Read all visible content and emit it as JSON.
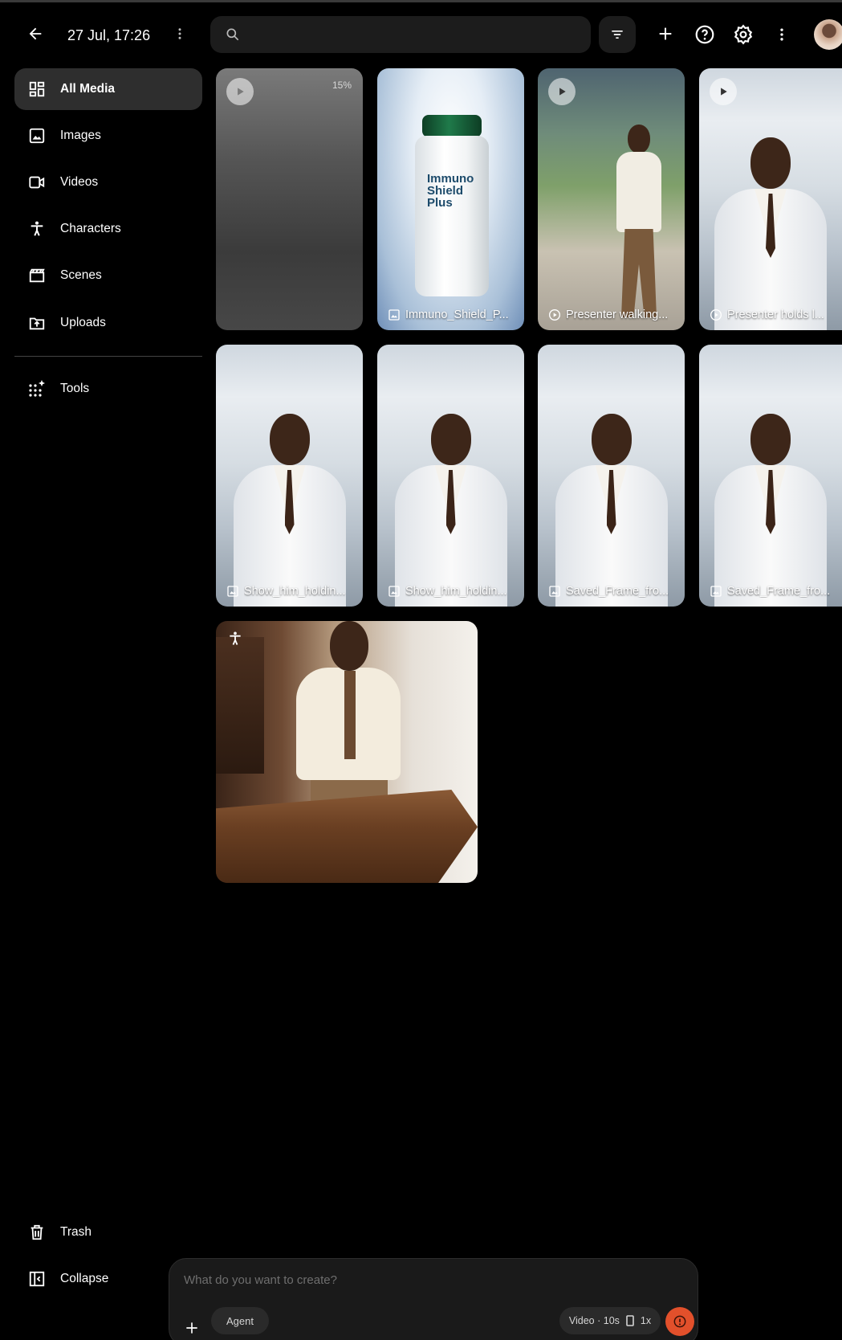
{
  "header": {
    "back_icon": "arrow-back-icon",
    "session_title": "27 Jul, 17:26",
    "search": {
      "value": "",
      "placeholder": ""
    },
    "icons": [
      "more-vert-icon",
      "search-icon",
      "filter-icon",
      "add-icon",
      "help-icon",
      "settings-icon",
      "more-vert-icon",
      "avatar"
    ]
  },
  "sidebar": {
    "items": [
      {
        "label": "All Media",
        "icon": "grid-icon",
        "active": true
      },
      {
        "label": "Images",
        "icon": "image-icon"
      },
      {
        "label": "Videos",
        "icon": "video-icon"
      },
      {
        "label": "Characters",
        "icon": "character-icon"
      },
      {
        "label": "Scenes",
        "icon": "clapperboard-icon"
      },
      {
        "label": "Uploads",
        "icon": "upload-folder-icon"
      },
      {
        "label": "Tools",
        "icon": "tools-sparkle-icon"
      }
    ],
    "footer": [
      {
        "label": "Trash",
        "icon": "trash-icon"
      },
      {
        "label": "Collapse",
        "icon": "collapse-icon"
      }
    ]
  },
  "media": {
    "items": [
      {
        "type": "video-generating",
        "progress_label": "15%",
        "progress": 0.15
      },
      {
        "type": "image",
        "label": "Immuno_Shield_P...",
        "product_text": "Immuno Shield Plus"
      },
      {
        "type": "video",
        "label": "Presenter walking..."
      },
      {
        "type": "video",
        "label": "Presenter holds l..."
      },
      {
        "type": "image",
        "label": "Show_him_holdin..."
      },
      {
        "type": "image",
        "label": "Show_him_holdin..."
      },
      {
        "type": "image",
        "label": "Saved_Frame_fro..."
      },
      {
        "type": "image",
        "label": "Saved_Frame_fro..."
      },
      {
        "type": "character"
      }
    ]
  },
  "composer": {
    "placeholder": "What do you want to create?",
    "agent_label": "Agent",
    "settings_label": "Video · 10s",
    "speed_label": "1x",
    "colors": {
      "send": "#e2502b"
    }
  }
}
